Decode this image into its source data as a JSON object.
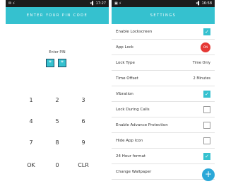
{
  "left_phone": {
    "status": {
      "left": "✉ ⚡",
      "right": "▾▌ 17:27"
    },
    "title": "ENTER YOUR PIN CODE",
    "pin_label": "Enter PIN",
    "pin_dots": [
      "*",
      "*"
    ],
    "keypad": [
      "1",
      "2",
      "3",
      "4",
      "5",
      "6",
      "7",
      "8",
      "9",
      "OK",
      "0",
      "CLR"
    ]
  },
  "right_phone": {
    "status": {
      "left": "▣ ⚡",
      "right": "▾▌ 16:58"
    },
    "title": "SETTINGS",
    "rows": [
      {
        "label": "Enable Lockscreen",
        "control": "checkbox",
        "checked": true
      },
      {
        "label": "App Lock",
        "control": "toggle",
        "toggle_text": "ON"
      },
      {
        "label": "Lock Type",
        "control": "value",
        "value": "Time Only"
      },
      {
        "label": "Time Offset",
        "control": "value",
        "value": "2 Minutes"
      },
      {
        "label": "Vibration",
        "control": "checkbox",
        "checked": true
      },
      {
        "label": "Lock During Calls",
        "control": "checkbox",
        "checked": false
      },
      {
        "label": "Enable Advance Protection",
        "control": "checkbox",
        "checked": false
      },
      {
        "label": "Hide App Icon",
        "control": "checkbox",
        "checked": false
      },
      {
        "label": "24 Hour format",
        "control": "checkbox",
        "checked": true
      },
      {
        "label": "Change Wallpaper",
        "control": "none"
      }
    ],
    "fab_icon": "+"
  },
  "colors": {
    "accent": "#35c1cf",
    "toggle_red": "#e53935",
    "fab": "#2ba8d8",
    "status_bar": "#1c1c1c"
  },
  "icons": {
    "checkmark": "✓"
  }
}
